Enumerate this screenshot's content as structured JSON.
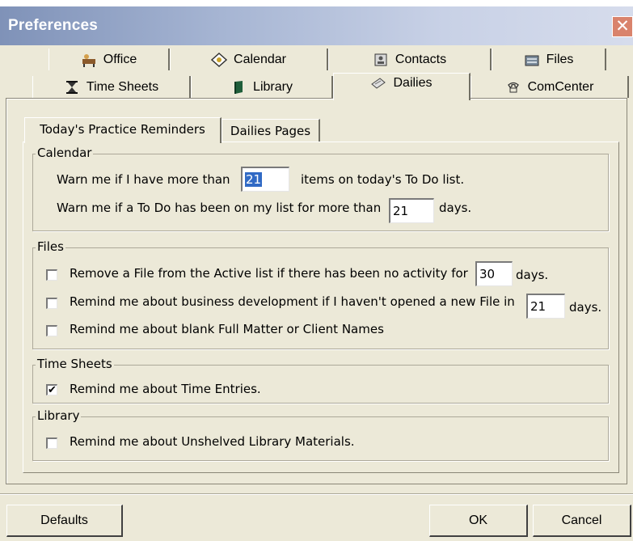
{
  "window": {
    "title": "Preferences",
    "close_glyph": "✕"
  },
  "tabs_row1": [
    {
      "label": "Office",
      "icon": "office-icon"
    },
    {
      "label": "Calendar",
      "icon": "calendar-icon"
    },
    {
      "label": "Contacts",
      "icon": "contacts-icon"
    },
    {
      "label": "Files",
      "icon": "files-icon"
    }
  ],
  "tabs_row2": [
    {
      "label": "Time Sheets",
      "icon": "hourglass-icon"
    },
    {
      "label": "Library",
      "icon": "book-icon"
    },
    {
      "label": "Dailies",
      "icon": "dailies-icon",
      "active": true
    },
    {
      "label": "ComCenter",
      "icon": "phone-icon"
    }
  ],
  "subtabs": [
    {
      "label": "Today's Practice Reminders",
      "active": true
    },
    {
      "label": "Dailies Pages",
      "active": false
    }
  ],
  "calendar": {
    "legend": "Calendar",
    "warn_todo_prefix": "Warn me if I have more than",
    "warn_todo_value": "21",
    "warn_todo_suffix": "items on today's To Do list.",
    "warn_days_prefix": "Warn me if a To Do has been on my list for more than",
    "warn_days_value": "21",
    "warn_days_suffix": "days."
  },
  "files": {
    "legend": "Files",
    "remove_label": "Remove a File from the Active list if there has been no activity for",
    "remove_value": "30",
    "remove_suffix": "days.",
    "remove_checked": false,
    "bizdev_label": "Remind me about business development if I haven't opened a new File in",
    "bizdev_value": "21",
    "bizdev_suffix": "days.",
    "bizdev_checked": false,
    "blank_label": "Remind me about blank Full Matter or Client Names",
    "blank_checked": false
  },
  "timesheets": {
    "legend": "Time Sheets",
    "entries_label": "Remind me about Time Entries.",
    "entries_checked": true
  },
  "library": {
    "legend": "Library",
    "unshelved_label": "Remind me about Unshelved Library Materials.",
    "unshelved_checked": false
  },
  "buttons": {
    "defaults": "Defaults",
    "ok": "OK",
    "cancel": "Cancel"
  },
  "check_glyph": "✔"
}
